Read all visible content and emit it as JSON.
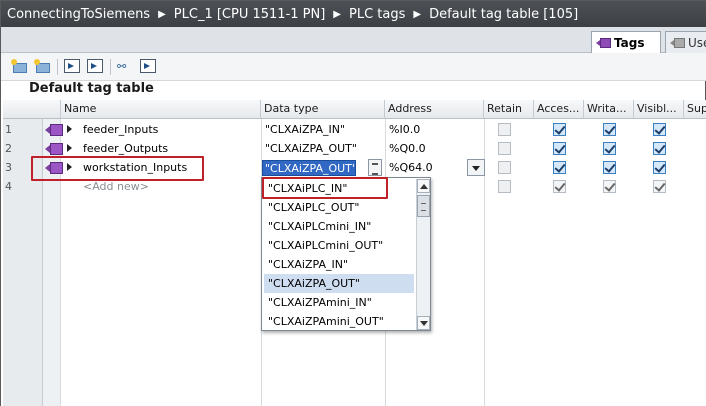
{
  "titlebar": {
    "crumbs": [
      "ConnectingToSiemens",
      "PLC_1 [CPU 1511-1 PN]",
      "PLC tags",
      "Default tag table [105]"
    ]
  },
  "tabs": {
    "active": "Tags",
    "inactive": "Use"
  },
  "toolbar_icons": [
    "add-tag-icon",
    "insert-row-icon",
    "export-icon",
    "import-icon",
    "monitor-glasses-icon",
    "settings-icon"
  ],
  "table": {
    "title": "Default tag table",
    "columns": [
      "Name",
      "Data type",
      "Address",
      "Retain",
      "Acces...",
      "Writa...",
      "Visibl...",
      "Sup"
    ],
    "rows": [
      {
        "num": "1",
        "name": "feeder_Inputs",
        "datatype": "\"CLXAiZPA_IN\"",
        "address": "%I0.0",
        "retain": false,
        "access": true,
        "write": true,
        "visible": true
      },
      {
        "num": "2",
        "name": "feeder_Outputs",
        "datatype": "\"CLXAiZPA_OUT\"",
        "address": "%Q0.0",
        "retain": false,
        "access": true,
        "write": true,
        "visible": true
      },
      {
        "num": "3",
        "name": "workstation_Inputs",
        "datatype": "\"CLXAiZPA_OUT\"",
        "address": "%Q64.0",
        "retain": false,
        "access": true,
        "write": true,
        "visible": true
      },
      {
        "num": "4",
        "name": "<Add new>",
        "datatype": "",
        "address": "",
        "retain": false,
        "access": true,
        "write": true,
        "visible": true
      }
    ]
  },
  "dropdown": {
    "items": [
      "\"CLXAiPLC_IN\"",
      "\"CLXAiPLC_OUT\"",
      "\"CLXAiPLCmini_IN\"",
      "\"CLXAiPLCmini_OUT\"",
      "\"CLXAiZPA_IN\"",
      "\"CLXAiZPA_OUT\"",
      "\"CLXAiZPAmini_IN\"",
      "\"CLXAiZPAmini_OUT\""
    ],
    "selected_index": 5
  },
  "colors": {
    "titlebar": "#45494e",
    "selection": "#3168c3",
    "highlight": "#c0202a",
    "tag_icon": "#9b55c4"
  }
}
